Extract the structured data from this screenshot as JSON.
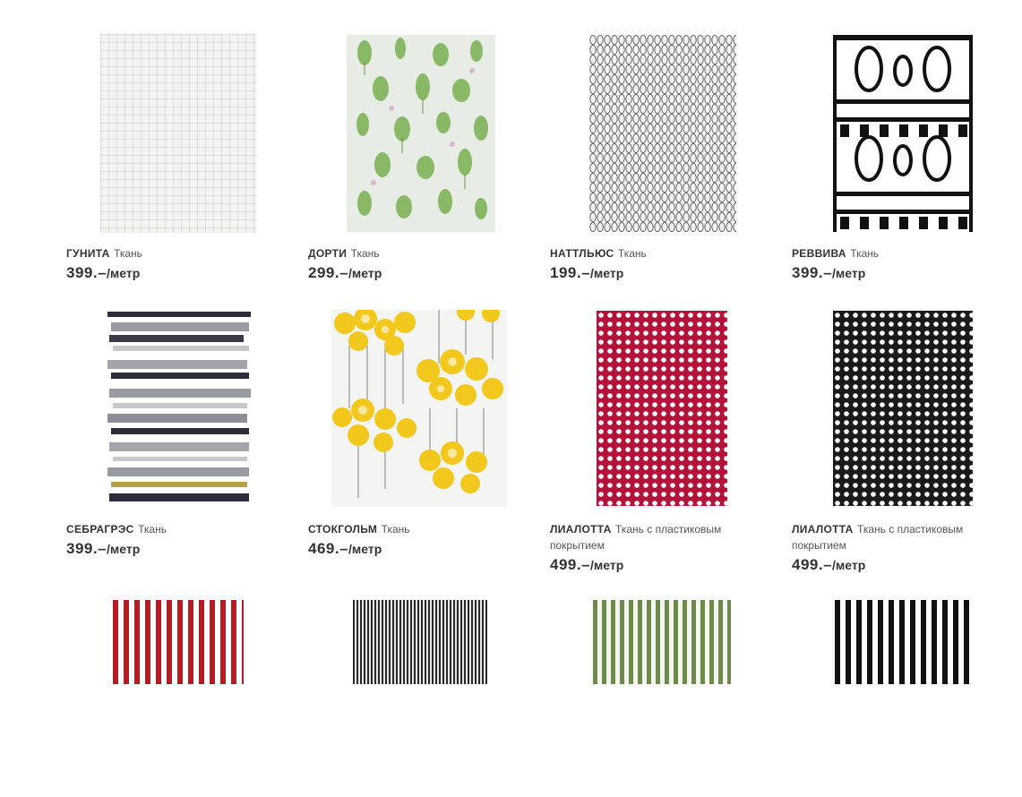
{
  "products": [
    {
      "name": "ГУНИТА",
      "type": "Ткань",
      "price": "399.–",
      "unit": "/метр"
    },
    {
      "name": "ДОРТИ",
      "type": "Ткань",
      "price": "299.–",
      "unit": "/метр"
    },
    {
      "name": "НАТТЛЬЮС",
      "type": "Ткань",
      "price": "199.–",
      "unit": "/метр"
    },
    {
      "name": "РЕВВИВА",
      "type": "Ткань",
      "price": "399.–",
      "unit": "/метр"
    },
    {
      "name": "СЕБРАГРЭС",
      "type": "Ткань",
      "price": "399.–",
      "unit": "/метр"
    },
    {
      "name": "СТОКГОЛЬМ",
      "type": "Ткань",
      "price": "469.–",
      "unit": "/метр"
    },
    {
      "name": "ЛИАЛОТТА",
      "type": "Ткань с пластиковым покрытием",
      "price": "499.–",
      "unit": "/метр"
    },
    {
      "name": "ЛИАЛОТТА",
      "type": "Ткань с пластиковым покрытием",
      "price": "499.–",
      "unit": "/метр"
    },
    {
      "name": "",
      "type": "",
      "price": "",
      "unit": ""
    },
    {
      "name": "",
      "type": "",
      "price": "",
      "unit": ""
    },
    {
      "name": "",
      "type": "",
      "price": "",
      "unit": ""
    },
    {
      "name": "",
      "type": "",
      "price": "",
      "unit": ""
    }
  ]
}
